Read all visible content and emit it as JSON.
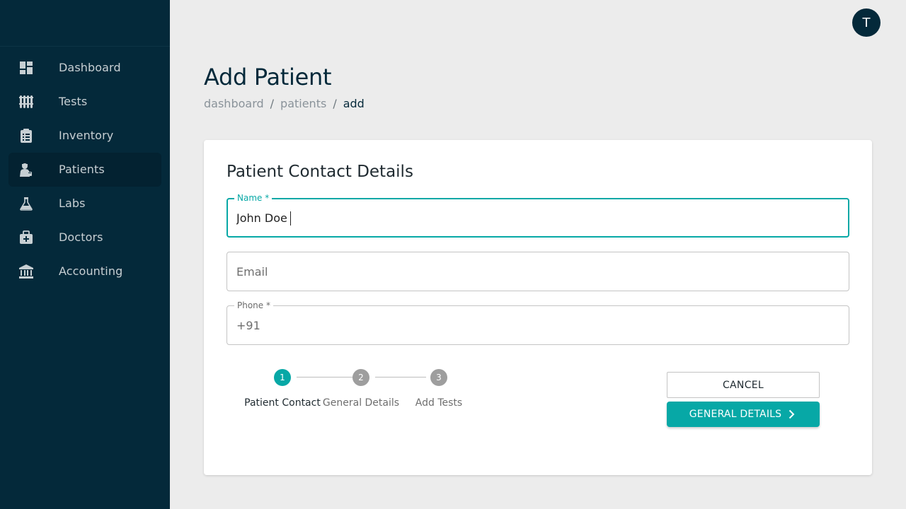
{
  "sidebar": {
    "items": [
      {
        "label": "Dashboard",
        "icon": "dashboard-icon"
      },
      {
        "label": "Tests",
        "icon": "test-tubes-icon"
      },
      {
        "label": "Inventory",
        "icon": "clipboard-icon"
      },
      {
        "label": "Patients",
        "icon": "patient-icon",
        "active": true
      },
      {
        "label": "Labs",
        "icon": "flask-icon"
      },
      {
        "label": "Doctors",
        "icon": "medical-kit-icon"
      },
      {
        "label": "Accounting",
        "icon": "bank-icon"
      }
    ]
  },
  "header": {
    "avatar_initial": "T"
  },
  "page": {
    "title": "Add Patient",
    "breadcrumb": [
      "dashboard",
      "patients",
      "add"
    ]
  },
  "form": {
    "title": "Patient Contact Details",
    "name": {
      "label": "Name *",
      "value": "John Doe"
    },
    "email": {
      "placeholder": "Email",
      "value": ""
    },
    "phone": {
      "label": "Phone *",
      "value": "+91"
    }
  },
  "stepper": {
    "steps": [
      {
        "number": "1",
        "label": "Patient Contact",
        "active": true
      },
      {
        "number": "2",
        "label": "General Details",
        "active": false
      },
      {
        "number": "3",
        "label": "Add Tests",
        "active": false
      }
    ]
  },
  "actions": {
    "cancel_label": "CANCEL",
    "next_label": "GENERAL DETAILS"
  },
  "colors": {
    "sidebar_bg": "#04293a",
    "accent": "#07a8a6",
    "page_bg": "#ececec"
  }
}
